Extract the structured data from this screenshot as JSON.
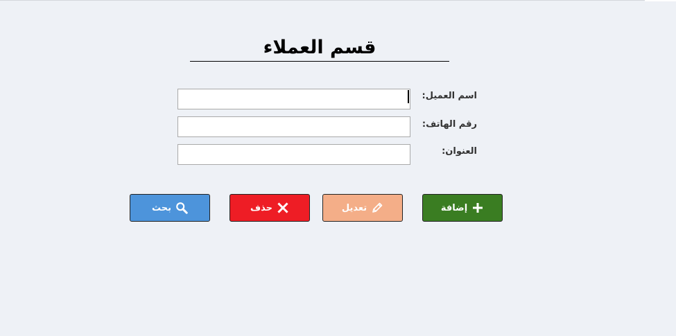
{
  "page": {
    "title": "قسم العملاء"
  },
  "form": {
    "customer_name_label": "اسم العميل:",
    "customer_name_value": "",
    "phone_label": "رقم الهاتف:",
    "phone_value": "",
    "address_label": "العنوان:",
    "address_value": ""
  },
  "buttons": {
    "add_label": "إضافة",
    "add_icon": "plus-icon",
    "add_color": "#3a7d22",
    "edit_label": "تعديل",
    "edit_icon": "pencil-icon",
    "edit_color": "#f4ae88",
    "delete_label": "حذف",
    "delete_icon": "close-icon",
    "delete_color": "#ee1d25",
    "search_label": "بحث",
    "search_icon": "search-icon",
    "search_color": "#4d94db"
  }
}
